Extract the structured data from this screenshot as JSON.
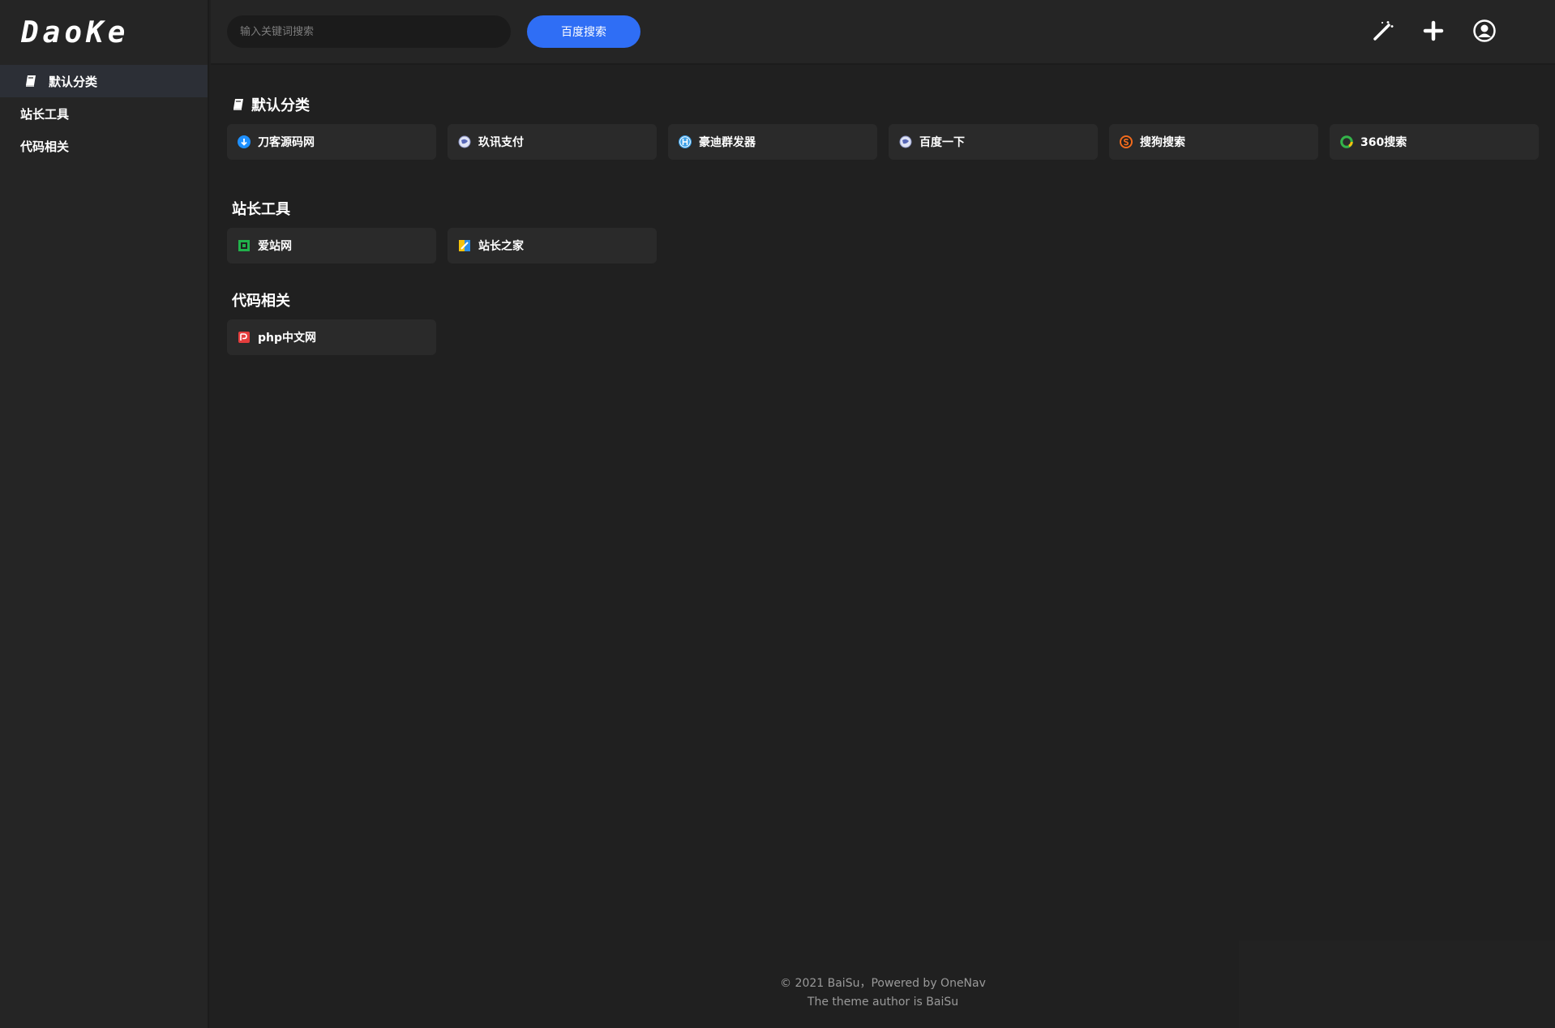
{
  "brand": {
    "logo_text": "DaoKe"
  },
  "sidebar": {
    "items": [
      {
        "label": "默认分类",
        "icon": "book-icon",
        "active": true
      },
      {
        "label": "站长工具",
        "active": false
      },
      {
        "label": "代码相关",
        "active": false
      }
    ]
  },
  "header": {
    "search_placeholder": "输入关键词搜索",
    "search_button": "百度搜索",
    "icons": [
      "magic-wand-icon",
      "plus-icon",
      "user-circle-icon"
    ]
  },
  "sections": [
    {
      "title": "默认分类",
      "icon": "book-icon",
      "links": [
        {
          "label": "刀客源码网",
          "icon": "cloud-download-icon",
          "color": "#1e90ff"
        },
        {
          "label": "玖讯支付",
          "icon": "globe-icon",
          "color": "#c7cde8"
        },
        {
          "label": "豪迪群发器",
          "icon": "h-circle-icon",
          "color": "#3aa0e8"
        },
        {
          "label": "百度一下",
          "icon": "globe-icon",
          "color": "#c7cde8"
        },
        {
          "label": "搜狗搜索",
          "icon": "sogou-icon",
          "color": "#f26b1d"
        },
        {
          "label": "360搜索",
          "icon": "ring-icon",
          "color": "#34b44a"
        }
      ]
    },
    {
      "title": "站长工具",
      "links": [
        {
          "label": "爱站网",
          "icon": "aizhan-icon",
          "color": "#21b14b"
        },
        {
          "label": "站长之家",
          "icon": "chinaz-icon",
          "color": "#f4c20d"
        }
      ]
    },
    {
      "title": "代码相关",
      "links": [
        {
          "label": "php中文网",
          "icon": "php-icon",
          "color": "#e43d3d"
        }
      ]
    }
  ],
  "footer": {
    "line1": "© 2021 BaiSu，Powered by OneNav",
    "line2": "The theme author is BaiSu"
  }
}
